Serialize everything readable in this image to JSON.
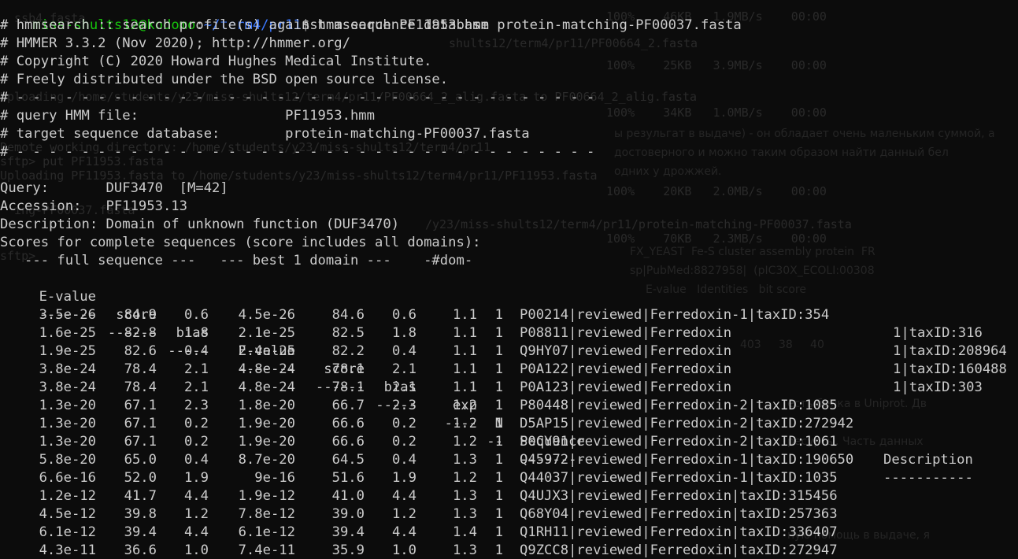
{
  "prompt": {
    "user_host": "miss-shults12@kodomo",
    "separator": ":",
    "path": "~/term4/pr11",
    "symbol": "$ ",
    "command": "hmmsearch PF11953.hmm protein-matching-PF00037.fasta"
  },
  "header_lines": [
    "# hmmsearch :: search profile(s) against a sequence database",
    "# HMMER 3.3.2 (Nov 2020); http://hmmer.org/",
    "# Copyright (C) 2020 Howard Hughes Medical Institute.",
    "# Freely distributed under the BSD open source license.",
    "# - - - - - - - - - - - - - - - - - - - - - - - - - - - - - - - - - - - -",
    "# query HMM file:                  PF11953.hmm",
    "# target sequence database:        protein-matching-PF00037.fasta",
    "# - - - - - - - - - - - - - - - - - - - - - - - - - - - - - - - - - - - -"
  ],
  "query_lines": [
    "Query:       DUF3470  [M=42]",
    "Accession:   PF11953.13",
    "Description: Domain of unknown function (DUF3470)",
    "Scores for complete sequences (score includes all domains):"
  ],
  "table_group_header": "   --- full sequence ---   --- best 1 domain ---    -#dom-",
  "table_columns": [
    "E-value",
    "score",
    "bias",
    "E-value",
    "score",
    "bias",
    "exp",
    "N",
    "Sequence",
    "Description"
  ],
  "table_separators": [
    "-------",
    "------",
    "-----",
    "-------",
    "------",
    "-----",
    "----",
    "--",
    "--------",
    "-----------"
  ],
  "rows": [
    [
      "3.5e-26",
      "84.9",
      "0.6",
      "4.5e-26",
      "84.6",
      "0.6",
      "1.1",
      "1",
      "P00214|reviewed|Ferredoxin-1|taxID:354",
      ""
    ],
    [
      "1.6e-25",
      "82.8",
      "1.8",
      "2.1e-25",
      "82.5",
      "1.8",
      "1.1",
      "1",
      "P08811|reviewed|Ferredoxin",
      "1|taxID:316"
    ],
    [
      "1.9e-25",
      "82.6",
      "0.4",
      "2.4e-25",
      "82.2",
      "0.4",
      "1.1",
      "1",
      "Q9HY07|reviewed|Ferredoxin",
      "1|taxID:208964"
    ],
    [
      "3.8e-24",
      "78.4",
      "2.1",
      "4.8e-24",
      "78.1",
      "2.1",
      "1.1",
      "1",
      "P0A122|reviewed|Ferredoxin",
      "1|taxID:160488"
    ],
    [
      "3.8e-24",
      "78.4",
      "2.1",
      "4.8e-24",
      "78.1",
      "2.1",
      "1.1",
      "1",
      "P0A123|reviewed|Ferredoxin",
      "1|taxID:303"
    ],
    [
      "1.3e-20",
      "67.1",
      "2.3",
      "1.8e-20",
      "66.7",
      "2.3",
      "1.2",
      "1",
      "P80448|reviewed|Ferredoxin-2|taxID:1085",
      ""
    ],
    [
      "1.3e-20",
      "67.1",
      "0.2",
      "1.9e-20",
      "66.6",
      "0.2",
      "1.2",
      "1",
      "D5AP15|reviewed|Ferredoxin-2|taxID:272942",
      ""
    ],
    [
      "1.3e-20",
      "67.1",
      "0.2",
      "1.9e-20",
      "66.6",
      "0.2",
      "1.2",
      "1",
      "P0CY91|reviewed|Ferredoxin-2|taxID:1061",
      ""
    ],
    [
      "5.8e-20",
      "65.0",
      "0.4",
      "8.7e-20",
      "64.5",
      "0.4",
      "1.3",
      "1",
      "Q45972|reviewed|Ferredoxin-1|taxID:190650",
      ""
    ],
    [
      "6.6e-16",
      "52.0",
      "1.9",
      "9e-16",
      "51.6",
      "1.9",
      "1.2",
      "1",
      "Q44037|reviewed|Ferredoxin-1|taxID:1035",
      ""
    ],
    [
      "1.2e-12",
      "41.7",
      "4.4",
      "1.9e-12",
      "41.0",
      "4.4",
      "1.3",
      "1",
      "Q4UJX3|reviewed|Ferredoxin|taxID:315456",
      ""
    ],
    [
      "4.5e-12",
      "39.8",
      "1.2",
      "7.8e-12",
      "39.0",
      "1.2",
      "1.3",
      "1",
      "Q68Y04|reviewed|Ferredoxin|taxID:257363",
      ""
    ],
    [
      "6.1e-12",
      "39.4",
      "4.4",
      "6.1e-12",
      "39.4",
      "4.4",
      "1.4",
      "1",
      "Q1RH11|reviewed|Ferredoxin|taxID:336407",
      ""
    ],
    [
      "4.3e-11",
      "36.6",
      "1.0",
      "7.4e-11",
      "35.9",
      "1.0",
      "1.3",
      "1",
      "Q9ZCC8|reviewed|Ferredoxin|taxID:272947",
      ""
    ]
  ],
  "colors": {
    "background": "#0c0c0c",
    "text": "#cccccc",
    "prompt_user": "#16c60c",
    "prompt_path": "#3b78ff"
  }
}
